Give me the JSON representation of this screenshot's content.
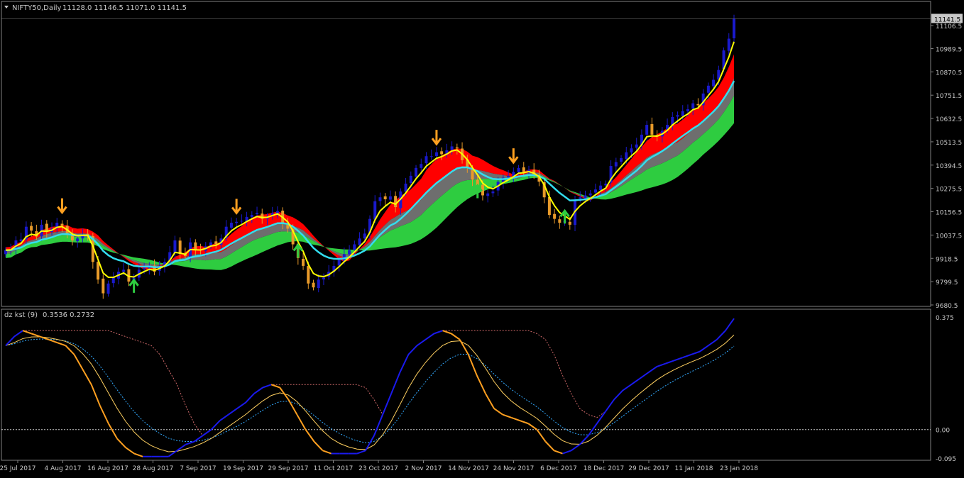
{
  "header": {
    "symbol": "NIFTY50,Daily",
    "ohlc": "11128.0 11146.5 11071.0 11141.5"
  },
  "indicator": {
    "name": "dz kst (9)",
    "values": "0.3536 0.2732"
  },
  "price_axis": {
    "ticks": [
      "11106.5",
      "10989.5",
      "10870.5",
      "10751.5",
      "10632.5",
      "10513.5",
      "10394.5",
      "10275.5",
      "10156.5",
      "10037.5",
      "9918.5",
      "9799.5",
      "9680.5"
    ],
    "current_price": "11141.5"
  },
  "ind_axis": {
    "ticks": [
      "0.375",
      "0.00",
      "-0.095"
    ]
  },
  "date_axis": {
    "labels": [
      "25 Jul 2017",
      "4 Aug 2017",
      "16 Aug 2017",
      "28 Aug 2017",
      "7 Sep 2017",
      "19 Sep 2017",
      "29 Sep 2017",
      "11 Oct 2017",
      "23 Oct 2017",
      "2 Nov 2017",
      "14 Nov 2017",
      "24 Nov 2017",
      "6 Dec 2017",
      "18 Dec 2017",
      "29 Dec 2017",
      "11 Jan 2018",
      "23 Jan 2018"
    ]
  },
  "colors": {
    "bull": "#1a1acc",
    "bear": "#e89a2a",
    "neutral": "#6e6e6e",
    "band_red": "#ff0000",
    "band_gray": "#6e6e6e",
    "band_green": "#2ecc40",
    "fast_line": "#ffff00",
    "slow_line": "#33ddee",
    "kst_blue": "#1a1aee",
    "kst_orange": "#ffa020",
    "arrow_down": "#ffa020",
    "arrow_up": "#2ecc40"
  },
  "chart_data": {
    "type": "candlestick",
    "title": "NIFTY50,Daily",
    "ylim": [
      9680.5,
      11165
    ],
    "closes": [
      9960,
      9965,
      10010,
      10015,
      10080,
      10060,
      10030,
      10090,
      10055,
      10070,
      10100,
      10085,
      10040,
      10010,
      10020,
      10040,
      10035,
      9900,
      9810,
      9740,
      9790,
      9820,
      9850,
      9860,
      9800,
      9820,
      9860,
      9870,
      9880,
      9850,
      9880,
      9900,
      9950,
      10010,
      9940,
      9930,
      10000,
      9960,
      9960,
      9980,
      10000,
      9990,
      10020,
      10080,
      10100,
      10105,
      10110,
      10130,
      10140,
      10150,
      10120,
      10130,
      10150,
      10160,
      10100,
      10070,
      9990,
      9920,
      9880,
      9790,
      9770,
      9810,
      9820,
      9850,
      9880,
      9910,
      9940,
      9960,
      9990,
      10020,
      10045,
      10120,
      10210,
      10230,
      10220,
      10235,
      10180,
      10260,
      10300,
      10340,
      10380,
      10400,
      10440,
      10440,
      10460,
      10450,
      10470,
      10490,
      10480,
      10420,
      10380,
      10320,
      10290,
      10240,
      10250,
      10260,
      10310,
      10330,
      10340,
      10360,
      10380,
      10360,
      10370,
      10340,
      10310,
      10230,
      10140,
      10120,
      10100,
      10110,
      10090,
      10220,
      10230,
      10240,
      10250,
      10270,
      10290,
      10300,
      10390,
      10410,
      10430,
      10460,
      10480,
      10500,
      10550,
      10600,
      10550,
      10540,
      10570,
      10600,
      10640,
      10650,
      10670,
      10680,
      10710,
      10700,
      10760,
      10800,
      10830,
      10880,
      10980,
      11040,
      11141.5
    ],
    "kst_blue": [
      0.28,
      0.31,
      0.33,
      0.32,
      0.31,
      0.3,
      0.29,
      0.28,
      0.25,
      0.2,
      0.15,
      0.08,
      0.02,
      -0.03,
      -0.06,
      -0.08,
      -0.09,
      -0.09,
      -0.09,
      -0.09,
      -0.07,
      -0.05,
      -0.04,
      -0.02,
      0.0,
      0.03,
      0.05,
      0.07,
      0.09,
      0.12,
      0.14,
      0.15,
      0.14,
      0.1,
      0.05,
      0.0,
      -0.04,
      -0.07,
      -0.08,
      -0.08,
      -0.08,
      -0.08,
      -0.07,
      -0.02,
      0.05,
      0.12,
      0.19,
      0.25,
      0.28,
      0.3,
      0.32,
      0.33,
      0.32,
      0.3,
      0.25,
      0.18,
      0.12,
      0.07,
      0.05,
      0.04,
      0.03,
      0.02,
      0.0,
      -0.04,
      -0.07,
      -0.08,
      -0.07,
      -0.05,
      -0.02,
      0.02,
      0.06,
      0.1,
      0.13,
      0.15,
      0.17,
      0.19,
      0.21,
      0.22,
      0.23,
      0.24,
      0.25,
      0.26,
      0.28,
      0.3,
      0.33,
      0.37
    ]
  }
}
